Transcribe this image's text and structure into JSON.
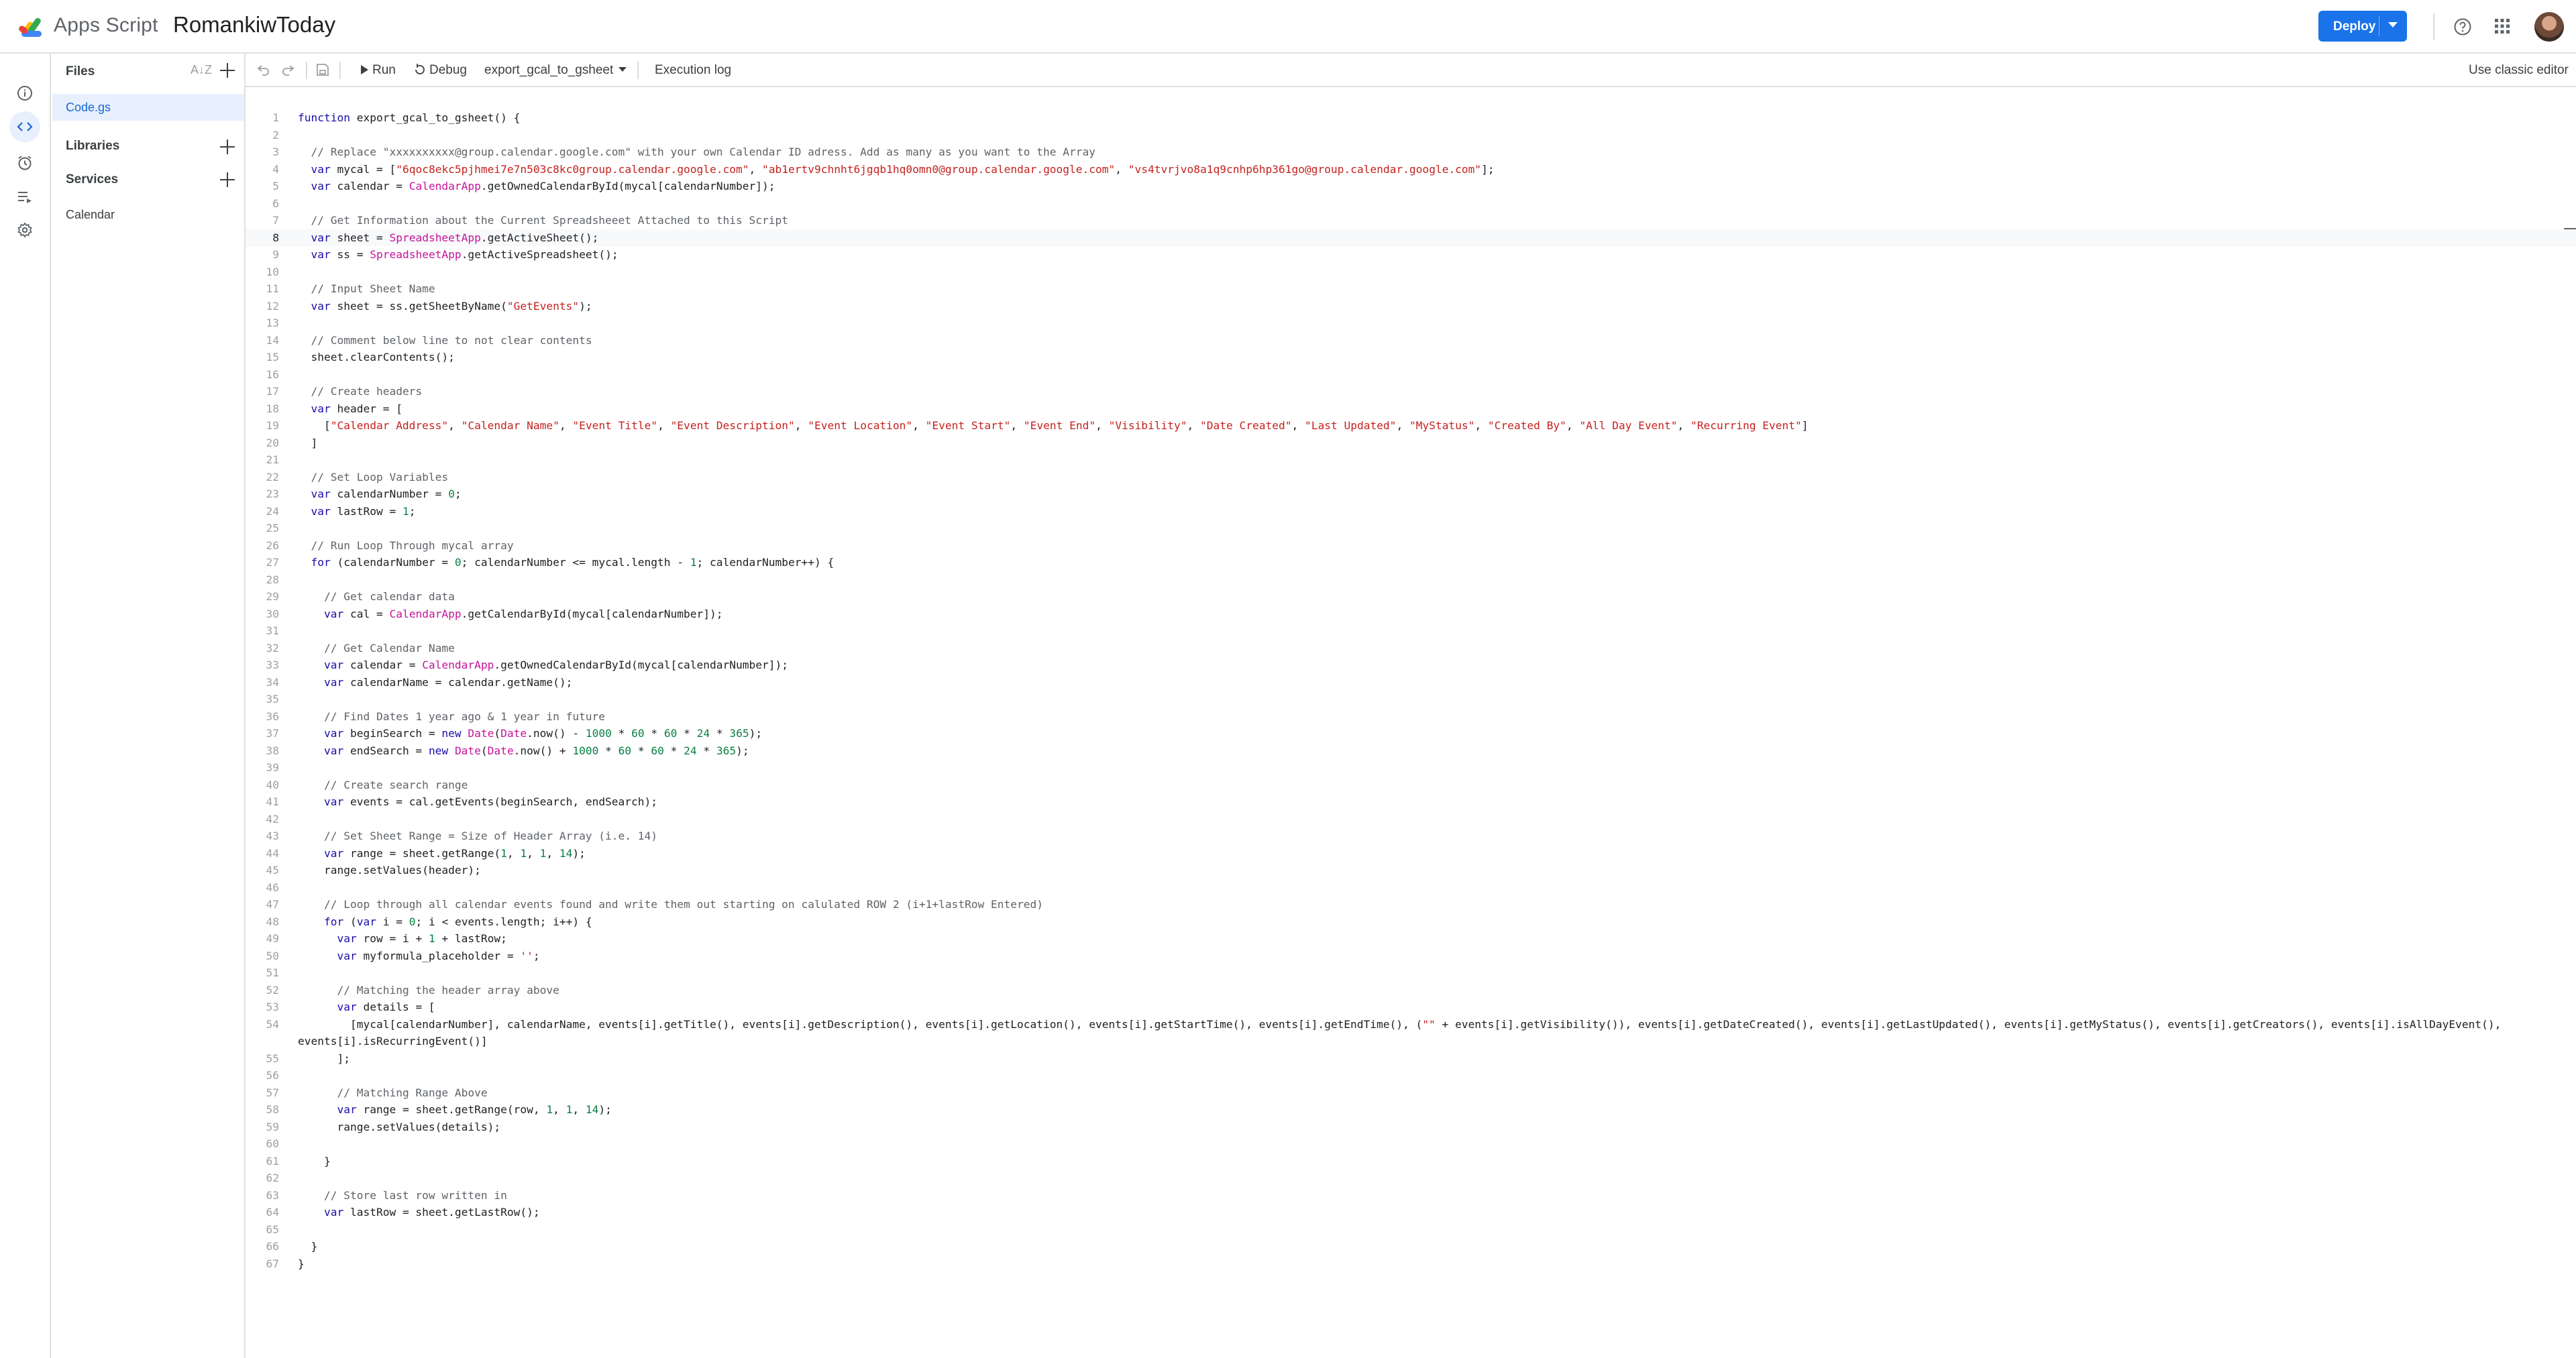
{
  "header": {
    "app_name": "Apps Script",
    "project_name": "RomankiwToday",
    "deploy_label": "Deploy"
  },
  "rail": {
    "items": [
      "overview",
      "editor",
      "triggers",
      "executions",
      "project-settings"
    ],
    "active": "editor"
  },
  "files_panel": {
    "title": "Files",
    "files": [
      "Code.gs"
    ],
    "libraries_label": "Libraries",
    "services_label": "Services",
    "services": [
      "Calendar"
    ]
  },
  "toolbar": {
    "run_label": "Run",
    "debug_label": "Debug",
    "function_name": "export_gcal_to_gsheet",
    "execution_log_label": "Execution log",
    "classic_label": "Use classic editor"
  },
  "editor": {
    "active_line": 8,
    "lines": [
      "function export_gcal_to_gsheet() {",
      "",
      "  // Replace \"xxxxxxxxxx@group.calendar.google.com\" with your own Calendar ID adress. Add as many as you want to the Array",
      "  var mycal = [\"6qoc8ekc5pjhmei7e7n503c8kc0group.calendar.google.com\", \"ab1ertv9chnht6jgqb1hq0omn0@group.calendar.google.com\", \"vs4tvrjvo8a1q9cnhp6hp361go@group.calendar.google.com\"];",
      "  var calendar = CalendarApp.getOwnedCalendarById(mycal[calendarNumber]);",
      "",
      "  // Get Information about the Current Spreadsheeet Attached to this Script",
      "  var sheet = SpreadsheetApp.getActiveSheet();",
      "  var ss = SpreadsheetApp.getActiveSpreadsheet();",
      "",
      "  // Input Sheet Name",
      "  var sheet = ss.getSheetByName(\"GetEvents\");",
      "",
      "  // Comment below line to not clear contents",
      "  sheet.clearContents();",
      "",
      "  // Create headers",
      "  var header = [",
      "    [\"Calendar Address\", \"Calendar Name\", \"Event Title\", \"Event Description\", \"Event Location\", \"Event Start\", \"Event End\", \"Visibility\", \"Date Created\", \"Last Updated\", \"MyStatus\", \"Created By\", \"All Day Event\", \"Recurring Event\"]",
      "  ]",
      "",
      "  // Set Loop Variables",
      "  var calendarNumber = 0;",
      "  var lastRow = 1;",
      "",
      "  // Run Loop Through mycal array",
      "  for (calendarNumber = 0; calendarNumber <= mycal.length - 1; calendarNumber++) {",
      "",
      "    // Get calendar data",
      "    var cal = CalendarApp.getCalendarById(mycal[calendarNumber]);",
      "",
      "    // Get Calendar Name",
      "    var calendar = CalendarApp.getOwnedCalendarById(mycal[calendarNumber]);",
      "    var calendarName = calendar.getName();",
      "",
      "    // Find Dates 1 year ago & 1 year in future",
      "    var beginSearch = new Date(Date.now() - 1000 * 60 * 60 * 24 * 365);",
      "    var endSearch = new Date(Date.now() + 1000 * 60 * 60 * 24 * 365);",
      "",
      "    // Create search range",
      "    var events = cal.getEvents(beginSearch, endSearch);",
      "",
      "    // Set Sheet Range = Size of Header Array (i.e. 14)",
      "    var range = sheet.getRange(1, 1, 1, 14);",
      "    range.setValues(header);",
      "",
      "    // Loop through all calendar events found and write them out starting on calulated ROW 2 (i+1+lastRow Entered)",
      "    for (var i = 0; i < events.length; i++) {",
      "      var row = i + 1 + lastRow;",
      "      var myformula_placeholder = '';",
      "",
      "      // Matching the header array above",
      "      var details = [",
      "        [mycal[calendarNumber], calendarName, events[i].getTitle(), events[i].getDescription(), events[i].getLocation(), events[i].getStartTime(), events[i].getEndTime(), (\"\" + events[i].getVisibility()), events[i].getDateCreated(), events[i].getLastUpdated(), events[i].getMyStatus(), events[i].getCreators(), events[i].isAllDayEvent(),|events[i].isRecurringEvent()]",
      "      ];",
      "",
      "      // Matching Range Above",
      "      var range = sheet.getRange(row, 1, 1, 14);",
      "      range.setValues(details);",
      "",
      "    }",
      "",
      "    // Store last row written in",
      "    var lastRow = sheet.getLastRow();",
      "",
      "  }",
      "}"
    ]
  }
}
